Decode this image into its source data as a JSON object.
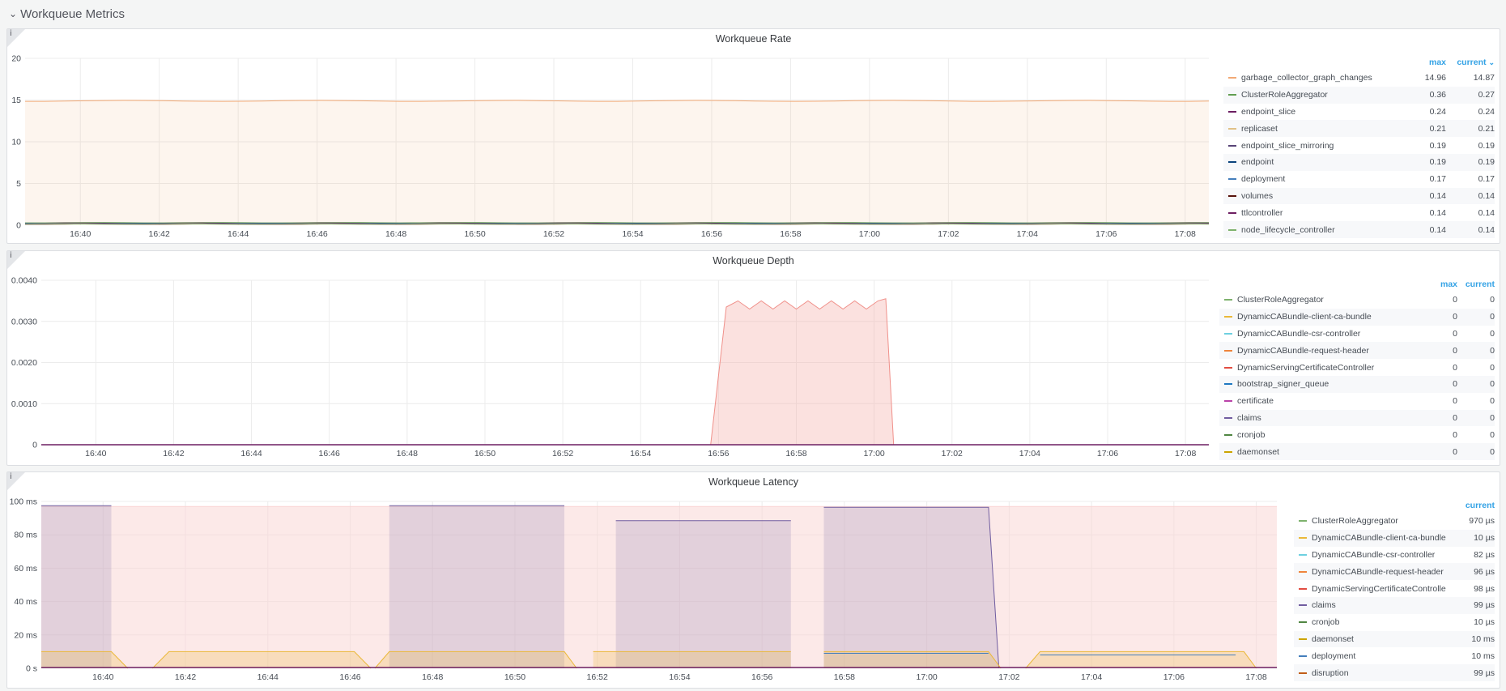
{
  "row": {
    "title": "Workqueue Metrics",
    "chevron_icon": "chevron-down-icon"
  },
  "panels": {
    "rate": {
      "title": "Workqueue Rate",
      "legend": {
        "col_max": "max",
        "col_current": "current",
        "sort_icon": "chevron-down-icon",
        "items": [
          {
            "name": "garbage_collector_graph_changes",
            "max": "14.96",
            "current": "14.87",
            "color": "#f2a975"
          },
          {
            "name": "ClusterRoleAggregator",
            "max": "0.36",
            "current": "0.27",
            "color": "#629e51"
          },
          {
            "name": "endpoint_slice",
            "max": "0.24",
            "current": "0.24",
            "color": "#6d1f62"
          },
          {
            "name": "replicaset",
            "max": "0.21",
            "current": "0.21",
            "color": "#e0c187"
          },
          {
            "name": "endpoint_slice_mirroring",
            "max": "0.19",
            "current": "0.19",
            "color": "#584477"
          },
          {
            "name": "endpoint",
            "max": "0.19",
            "current": "0.19",
            "color": "#0a437c"
          },
          {
            "name": "deployment",
            "max": "0.17",
            "current": "0.17",
            "color": "#447ebc"
          },
          {
            "name": "volumes",
            "max": "0.14",
            "current": "0.14",
            "color": "#58140c"
          },
          {
            "name": "ttlcontroller",
            "max": "0.14",
            "current": "0.14",
            "color": "#6d1f62"
          },
          {
            "name": "node_lifecycle_controller",
            "max": "0.14",
            "current": "0.14",
            "color": "#7eb26d"
          }
        ]
      }
    },
    "depth": {
      "title": "Workqueue Depth",
      "legend": {
        "col_max": "max",
        "col_current": "current",
        "items": [
          {
            "name": "ClusterRoleAggregator",
            "max": "0",
            "current": "0",
            "color": "#7eb26d"
          },
          {
            "name": "DynamicCABundle-client-ca-bundle",
            "max": "0",
            "current": "0",
            "color": "#eab839"
          },
          {
            "name": "DynamicCABundle-csr-controller",
            "max": "0",
            "current": "0",
            "color": "#6ed0e0"
          },
          {
            "name": "DynamicCABundle-request-header",
            "max": "0",
            "current": "0",
            "color": "#ef843c"
          },
          {
            "name": "DynamicServingCertificateController",
            "max": "0",
            "current": "0",
            "color": "#e24d42"
          },
          {
            "name": "bootstrap_signer_queue",
            "max": "0",
            "current": "0",
            "color": "#1f78c1"
          },
          {
            "name": "certificate",
            "max": "0",
            "current": "0",
            "color": "#ba43a9"
          },
          {
            "name": "claims",
            "max": "0",
            "current": "0",
            "color": "#705da0"
          },
          {
            "name": "cronjob",
            "max": "0",
            "current": "0",
            "color": "#508642"
          },
          {
            "name": "daemonset",
            "max": "0",
            "current": "0",
            "color": "#cca300"
          }
        ]
      }
    },
    "latency": {
      "title": "Workqueue Latency",
      "legend": {
        "col_current": "current",
        "items": [
          {
            "name": "ClusterRoleAggregator",
            "current": "970 µs",
            "color": "#7eb26d"
          },
          {
            "name": "DynamicCABundle-client-ca-bundle",
            "current": "10 µs",
            "color": "#eab839"
          },
          {
            "name": "DynamicCABundle-csr-controller",
            "current": "82 µs",
            "color": "#6ed0e0"
          },
          {
            "name": "DynamicCABundle-request-header",
            "current": "96 µs",
            "color": "#ef843c"
          },
          {
            "name": "DynamicServingCertificateController",
            "current": "98 µs",
            "color": "#e24d42"
          },
          {
            "name": "claims",
            "current": "99 µs",
            "color": "#705da0"
          },
          {
            "name": "cronjob",
            "current": "10 µs",
            "color": "#508642"
          },
          {
            "name": "daemonset",
            "current": "10 ms",
            "color": "#cca300"
          },
          {
            "name": "deployment",
            "current": "10 ms",
            "color": "#447ebc"
          },
          {
            "name": "disruption",
            "current": "99 µs",
            "color": "#c15c17"
          }
        ]
      }
    }
  },
  "chart_data": [
    {
      "type": "area",
      "title": "Workqueue Rate",
      "x_ticks": [
        "16:40",
        "16:42",
        "16:44",
        "16:46",
        "16:48",
        "16:50",
        "16:52",
        "16:54",
        "16:56",
        "16:58",
        "17:00",
        "17:02",
        "17:04",
        "17:06",
        "17:08"
      ],
      "y_ticks": [
        "0",
        "5",
        "10",
        "15",
        "20"
      ],
      "ylim": [
        0,
        20
      ],
      "xlim_minutes": [
        -1.4,
        28.6
      ],
      "grid": true,
      "legend_placement": "right",
      "series": [
        {
          "name": "garbage_collector_graph_changes",
          "color": "#f2a975",
          "fill": true,
          "value": 14.9
        },
        {
          "name": "ClusterRoleAggregator",
          "color": "#629e51",
          "value": 0.3
        },
        {
          "name": "endpoint_slice",
          "color": "#6d1f62",
          "value": 0.24
        },
        {
          "name": "replicaset",
          "color": "#e0c187",
          "value": 0.21
        },
        {
          "name": "endpoint_slice_mirroring",
          "color": "#584477",
          "value": 0.19
        },
        {
          "name": "endpoint",
          "color": "#0a437c",
          "value": 0.19
        },
        {
          "name": "deployment",
          "color": "#447ebc",
          "value": 0.17
        },
        {
          "name": "volumes",
          "color": "#58140c",
          "value": 0.14
        },
        {
          "name": "ttlcontroller",
          "color": "#6d1f62",
          "value": 0.14
        },
        {
          "name": "node_lifecycle_controller",
          "color": "#7eb26d",
          "value": 0.14
        }
      ]
    },
    {
      "type": "area",
      "title": "Workqueue Depth",
      "x_ticks": [
        "16:40",
        "16:42",
        "16:44",
        "16:46",
        "16:48",
        "16:50",
        "16:52",
        "16:54",
        "16:56",
        "16:58",
        "17:00",
        "17:02",
        "17:04",
        "17:06",
        "17:08"
      ],
      "y_ticks": [
        "0",
        "0.0010",
        "0.0020",
        "0.0030",
        "0.0040"
      ],
      "ylim": [
        0,
        0.004
      ],
      "xlim_minutes": [
        -1.4,
        28.6
      ],
      "grid": true,
      "legend_placement": "right",
      "series": [
        {
          "name": "DynamicServingCertificateController",
          "color": "#f4b3b0",
          "fill": true,
          "points": [
            [
              15.8,
              0
            ],
            [
              16.2,
              0.00335
            ],
            [
              16.5,
              0.0035
            ],
            [
              16.8,
              0.0033
            ],
            [
              17.1,
              0.0035
            ],
            [
              17.4,
              0.0033
            ],
            [
              17.7,
              0.0035
            ],
            [
              18.0,
              0.0033
            ],
            [
              18.3,
              0.0035
            ],
            [
              18.6,
              0.0033
            ],
            [
              18.9,
              0.0035
            ],
            [
              19.2,
              0.0033
            ],
            [
              19.5,
              0.0035
            ],
            [
              19.8,
              0.0033
            ],
            [
              20.1,
              0.0035
            ],
            [
              20.3,
              0.00355
            ],
            [
              20.5,
              0
            ]
          ]
        }
      ]
    },
    {
      "type": "area",
      "title": "Workqueue Latency",
      "x_ticks": [
        "16:40",
        "16:42",
        "16:44",
        "16:46",
        "16:48",
        "16:50",
        "16:52",
        "16:54",
        "16:56",
        "16:58",
        "17:00",
        "17:02",
        "17:04",
        "17:06",
        "17:08"
      ],
      "y_ticks": [
        "0 s",
        "20 ms",
        "40 ms",
        "60 ms",
        "80 ms",
        "100 ms"
      ],
      "ylim": [
        0,
        100
      ],
      "xlim_minutes": [
        -1.5,
        28.5
      ],
      "grid": true,
      "legend_placement": "right",
      "series": [
        {
          "name": "DynamicServingCertificateController",
          "color": "#f9d3d1",
          "fill": true,
          "points": [
            [
              -1.5,
              97
            ],
            [
              28.5,
              97
            ]
          ]
        },
        {
          "name": "claims",
          "color": "#705da0",
          "fill": true,
          "segments": [
            [
              [
                -1.5,
                97.5
              ],
              [
                0.2,
                97.5
              ]
            ],
            [
              [
                6.95,
                97.5
              ],
              [
                11.2,
                97.5
              ]
            ],
            [
              [
                12.45,
                88.5
              ],
              [
                16.7,
                88.5
              ]
            ],
            [
              [
                17.5,
                96.5
              ],
              [
                19.2,
                96.5
              ],
              [
                21.5,
                96.5
              ],
              [
                21.75,
                0
              ]
            ]
          ]
        },
        {
          "name": "daemonset",
          "color": "#eab839",
          "fill": true,
          "segments": [
            [
              [
                -1.5,
                10
              ],
              [
                0.2,
                10
              ],
              [
                0.6,
                0
              ]
            ],
            [
              [
                1.2,
                0
              ],
              [
                1.6,
                10
              ],
              [
                6.1,
                10
              ],
              [
                6.5,
                0
              ]
            ],
            [
              [
                6.6,
                0
              ],
              [
                6.95,
                10
              ],
              [
                11.2,
                10
              ],
              [
                11.5,
                0
              ]
            ],
            [
              [
                11.9,
                10
              ],
              [
                16.7,
                10
              ]
            ],
            [
              [
                17.5,
                10
              ],
              [
                21.5,
                10
              ],
              [
                21.8,
                0
              ]
            ],
            [
              [
                22.4,
                0
              ],
              [
                22.75,
                10
              ],
              [
                27.7,
                10
              ],
              [
                28.0,
                0
              ]
            ]
          ]
        },
        {
          "name": "deployment",
          "color": "#447ebc",
          "segments": [
            [
              [
                17.5,
                9
              ],
              [
                21.5,
                9
              ]
            ],
            [
              [
                22.75,
                8
              ],
              [
                27.5,
                8
              ]
            ]
          ]
        }
      ]
    }
  ]
}
